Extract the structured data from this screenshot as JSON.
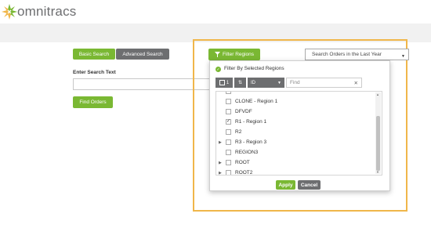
{
  "app": {
    "logo_text": "omnitracs"
  },
  "search": {
    "basic_tab": "Basic Search",
    "advanced_tab": "Advanced Search",
    "enter_label": "Enter Search Text",
    "text_value": "",
    "find_button": "Find Orders"
  },
  "filter_regions_button": "Filter Regions",
  "date_range_select": "Search Orders in the Last Year",
  "panel": {
    "filter_by_label": "Filter By Selected Regions",
    "sort_count": "1",
    "sort_field": "ID",
    "find_placeholder": "Find",
    "apply_button": "Apply",
    "cancel_button": "Cancel",
    "items": [
      {
        "label": "CLONE - Region 1",
        "checked": false,
        "expandable": false
      },
      {
        "label": "DFVDF",
        "checked": false,
        "expandable": false
      },
      {
        "label": "R1 - Region 1",
        "checked": true,
        "expandable": false
      },
      {
        "label": "R2",
        "checked": false,
        "expandable": false
      },
      {
        "label": "R3 - Region 3",
        "checked": false,
        "expandable": true
      },
      {
        "label": "REGION3",
        "checked": false,
        "expandable": false
      },
      {
        "label": "ROOT",
        "checked": false,
        "expandable": true
      },
      {
        "label": "ROOT2",
        "checked": false,
        "expandable": true
      }
    ]
  },
  "colors": {
    "accent_green": "#7ab833",
    "button_grey": "#6d6e70",
    "highlight": "#f0b64a"
  }
}
